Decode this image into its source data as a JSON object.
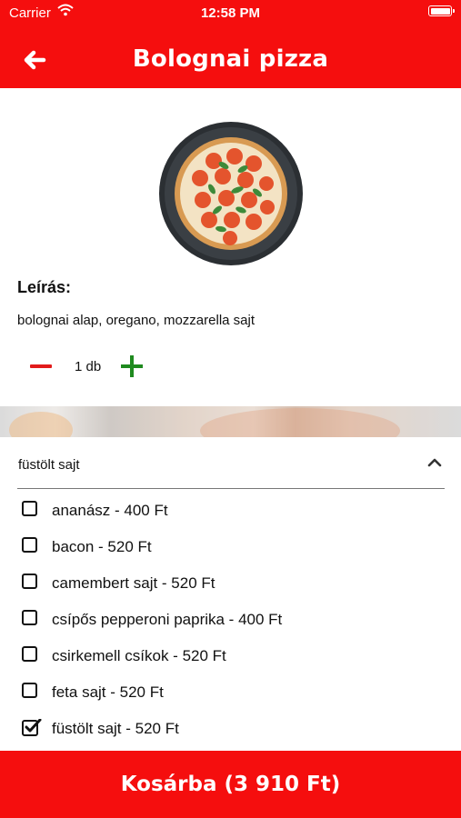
{
  "status_bar": {
    "carrier": "Carrier",
    "time": "12:58 PM"
  },
  "header": {
    "title": "Bolognai pizza",
    "back_icon": "arrow-left-icon"
  },
  "product": {
    "description_title": "Leírás:",
    "description": "bolognai alap, oregano, mozzarella sajt",
    "quantity": "1 db"
  },
  "extras": {
    "selected": "füstölt sajt",
    "options": [
      {
        "label": "ananász - 400 Ft",
        "checked": false
      },
      {
        "label": "bacon - 520 Ft",
        "checked": false
      },
      {
        "label": "camembert sajt - 520 Ft",
        "checked": false
      },
      {
        "label": "csípős pepperoni paprika - 400 Ft",
        "checked": false
      },
      {
        "label": "csirkemell csíkok - 520 Ft",
        "checked": false
      },
      {
        "label": "feta sajt - 520 Ft",
        "checked": false
      },
      {
        "label": "füstölt sajt - 520 Ft",
        "checked": true
      }
    ]
  },
  "cart_button": {
    "label": "Kosárba (3 910 Ft)"
  },
  "colors": {
    "brand": "#f50e0e",
    "minus": "#e21b1b",
    "plus": "#1f8a1f"
  }
}
